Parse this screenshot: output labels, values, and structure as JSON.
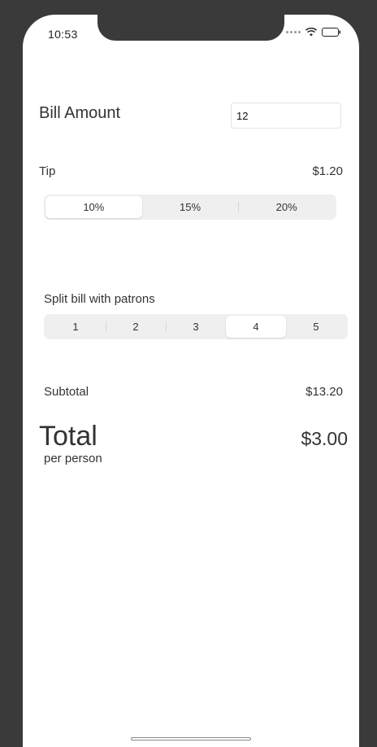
{
  "status_bar": {
    "time": "10:53",
    "icons": [
      "signal-dots-icon",
      "wifi-icon",
      "battery-icon"
    ]
  },
  "bill": {
    "label": "Bill Amount",
    "value": "12",
    "placeholder": ""
  },
  "tip": {
    "label": "Tip",
    "amount": "$1.20",
    "options": [
      "10%",
      "15%",
      "20%"
    ],
    "selected_index": 0
  },
  "split": {
    "label": "Split bill with patrons",
    "options": [
      "1",
      "2",
      "3",
      "4",
      "5"
    ],
    "selected_index": 3
  },
  "subtotal": {
    "label": "Subtotal",
    "value": "$13.20"
  },
  "total": {
    "label": "Total",
    "value": "$3.00",
    "per_person_label": "per person"
  },
  "colors": {
    "device_frame": "#3a3a3a",
    "screen_bg": "#ffffff",
    "segment_bg": "#efeff0",
    "text": "#333333"
  }
}
